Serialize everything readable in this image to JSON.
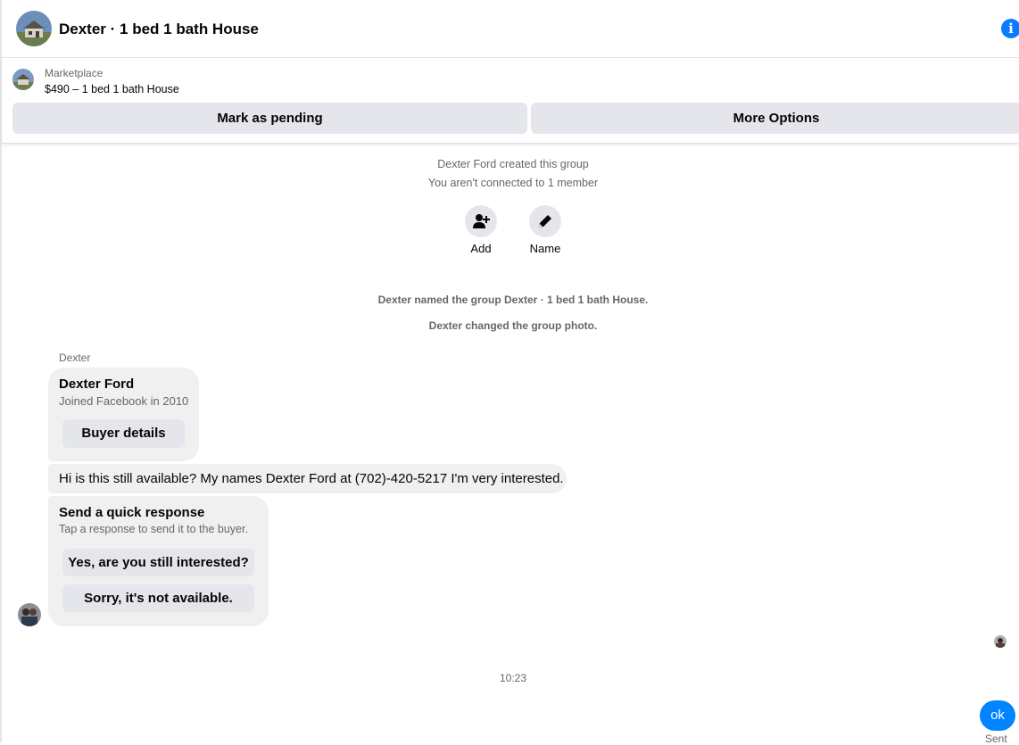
{
  "header": {
    "title": "Dexter · 1 bed 1 bath House",
    "info_icon": "info-icon",
    "info_glyph": "i"
  },
  "marketplace": {
    "label": "Marketplace",
    "listing": "$490 – 1 bed 1 bath House",
    "pending_button": "Mark as pending",
    "more_button": "More Options"
  },
  "group_info": {
    "created": "Dexter Ford created this group",
    "connection": "You aren't connected to 1 member",
    "actions": [
      {
        "label": "Add",
        "icon": "add-person-icon"
      },
      {
        "label": "Name",
        "icon": "pencil-icon"
      }
    ],
    "notes": [
      "Dexter named the group Dexter · 1 bed 1 bath House.",
      "Dexter changed the group photo."
    ]
  },
  "conversation": {
    "sender": "Dexter",
    "profile_card": {
      "name": "Dexter Ford",
      "joined": "Joined Facebook in 2010",
      "button": "Buyer details"
    },
    "message": "Hi is this still available? My names Dexter Ford at (702)-420-5217 I'm very interested.",
    "quick_response": {
      "title": "Send a quick response",
      "subtitle": "Tap a response to send it to the buyer.",
      "options": [
        "Yes, are you still interested?",
        "Sorry, it's not available."
      ]
    },
    "timestamp": "10:23",
    "outgoing": {
      "text": "ok",
      "status": "Sent"
    }
  },
  "colors": {
    "accent": "#0084ff",
    "bubble": "#f0f0f0",
    "button": "#e4e6eb",
    "muted_text": "#65676b"
  }
}
